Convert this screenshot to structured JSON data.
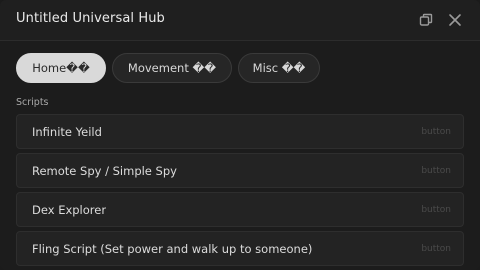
{
  "window": {
    "title": "Untitled Universal Hub"
  },
  "titlebar_icons": {
    "restore": "restore-icon",
    "close": "close-icon"
  },
  "tabs": [
    {
      "label": "Home��",
      "active": true
    },
    {
      "label": "Movement ��",
      "active": false
    },
    {
      "label": "Misc ��",
      "active": false
    }
  ],
  "section": {
    "label": "Scripts"
  },
  "scripts": [
    {
      "label": "Infinite Yeild",
      "hint": "button"
    },
    {
      "label": "Remote Spy / Simple Spy",
      "hint": "button"
    },
    {
      "label": "Dex Explorer",
      "hint": "button"
    },
    {
      "label": "Fling Script (Set power and walk up to someone)",
      "hint": "button"
    }
  ],
  "colors": {
    "background": "#1c1c1c",
    "active_tab": "#d9d9d9",
    "row": "#232323"
  }
}
